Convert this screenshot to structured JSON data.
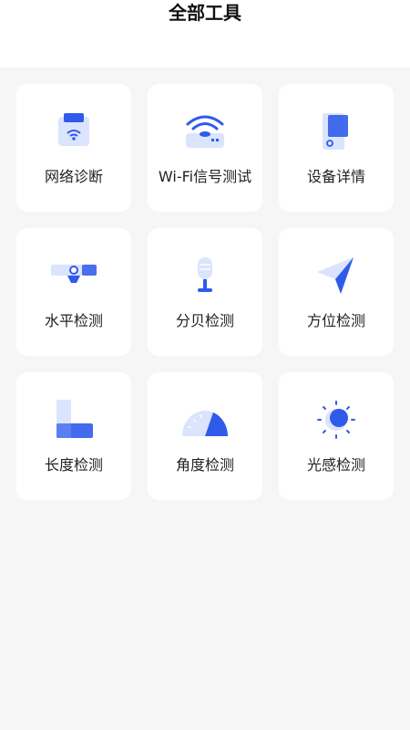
{
  "page": {
    "title": "全部工具"
  },
  "colors": {
    "accent": "#2f5bea",
    "accent_light": "#c9d6fb",
    "background": "#f6f6f6",
    "card": "#ffffff"
  },
  "tools": [
    {
      "label": "网络诊断",
      "icon": "network-diagnosis-icon"
    },
    {
      "label": "Wi-Fi信号测试",
      "icon": "wifi-signal-icon"
    },
    {
      "label": "设备详情",
      "icon": "device-details-icon"
    },
    {
      "label": "水平检测",
      "icon": "level-detection-icon"
    },
    {
      "label": "分贝检测",
      "icon": "microphone-icon"
    },
    {
      "label": "方位检测",
      "icon": "compass-arrow-icon"
    },
    {
      "label": "长度检测",
      "icon": "ruler-length-icon"
    },
    {
      "label": "角度检测",
      "icon": "protractor-icon"
    },
    {
      "label": "光感检测",
      "icon": "sun-light-icon"
    }
  ]
}
